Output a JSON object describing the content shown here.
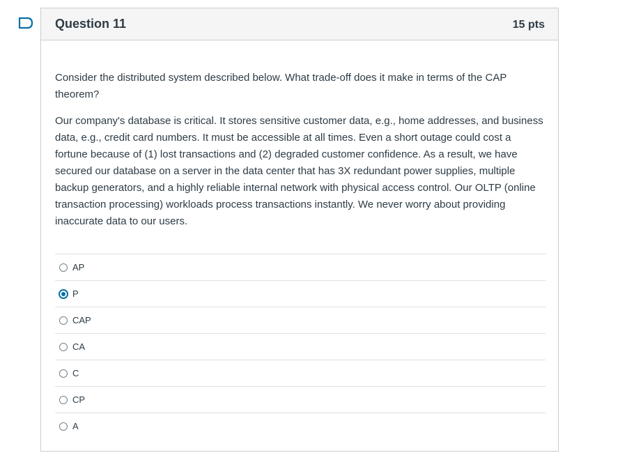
{
  "question": {
    "title": "Question 11",
    "points": "15 pts",
    "flag_icon": "flag-outline-icon",
    "paragraphs": [
      "Consider the distributed system described below. What trade-off does it make in terms of the CAP theorem?",
      "Our company's database is critical. It stores sensitive customer data, e.g., home addresses, and business data, e.g., credit card numbers. It must be accessible at all times. Even a short outage could cost a fortune because of (1) lost transactions and (2) degraded customer confidence. As a result, we have secured our database on a server in the data center that has 3X redundant power supplies, multiple backup generators, and a highly reliable internal network with physical access control. Our OLTP (online transaction processing) workloads process transactions instantly. We never worry about providing inaccurate data to our users."
    ],
    "answers": [
      {
        "label": "AP",
        "selected": false
      },
      {
        "label": "P",
        "selected": true
      },
      {
        "label": "CAP",
        "selected": false
      },
      {
        "label": "CA",
        "selected": false
      },
      {
        "label": "C",
        "selected": false
      },
      {
        "label": "CP",
        "selected": false
      },
      {
        "label": "A",
        "selected": false
      }
    ],
    "colors": {
      "accent": "#0770a3",
      "text": "#2d3b45",
      "header_bg": "#f5f5f5",
      "border": "#c7cdd1"
    }
  }
}
